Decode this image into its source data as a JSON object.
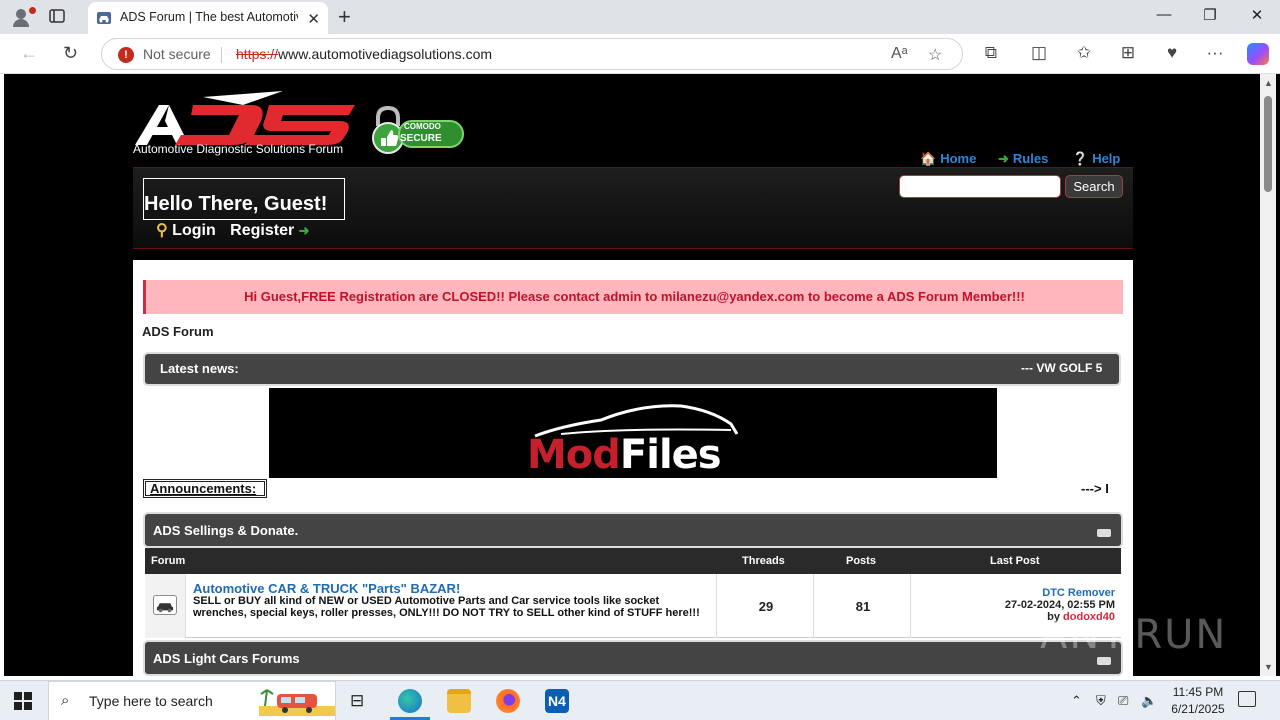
{
  "browser": {
    "tab_title": "ADS Forum | The best Automotive",
    "security_label": "Not secure",
    "url_protocol": "https://",
    "url_rest": "www.automotivediagsolutions.com"
  },
  "header": {
    "logo_caption": "Automotive Diagnostic Solutions Forum",
    "comodo_line1": "COMODO",
    "comodo_line2": "SECURE",
    "links": {
      "home": "Home",
      "rules": "Rules",
      "help": "Help"
    },
    "greeting": "Hello There, Guest!",
    "login": "Login",
    "register": "Register",
    "search_button": "Search",
    "search_value": ""
  },
  "content": {
    "notice": "Hi Guest,FREE Registration are CLOSED!! Please contact admin to milanezu@yandex.com to become a ADS Forum Member!!!",
    "breadcrumb": "ADS Forum",
    "latest_news_label": "Latest news:",
    "news_ticker": "--- VW GOLF 5",
    "banner_mod": "Mod",
    "banner_files": "Files",
    "announcements_label": "Announcements:",
    "announcements_ticker": "---> I",
    "categories": [
      {
        "name": "ADS Sellings & Donate."
      },
      {
        "name": "ADS Light Cars Forums"
      }
    ],
    "table_headers": {
      "forum": "Forum",
      "threads": "Threads",
      "posts": "Posts",
      "last_post": "Last Post"
    },
    "forums": [
      {
        "name": "Automotive CAR & TRUCK \"Parts\" BAZAR!",
        "description": "SELL or BUY all kind of NEW or USED Automotive Parts and Car service tools like socket wrenches, special keys, roller presses, ONLY!!! DO NOT TRY to SELL other kind of STUFF here!!!",
        "threads": "29",
        "posts": "81",
        "last_post_title": "DTC Remover",
        "last_post_date": "27-02-2024, 02:55 PM",
        "last_post_by_prefix": "by",
        "last_post_user": "dodoxd40"
      }
    ]
  },
  "watermark": "ANY.RUN",
  "taskbar": {
    "search_placeholder": "Type here to search",
    "time": "11:45 PM",
    "date": "6/21/2025"
  },
  "colors": {
    "accent_red": "#d9263b",
    "link_blue": "#1e6bb8",
    "header_link_blue": "#2e86d9",
    "category_bar": "#444444"
  },
  "icons": [
    "profile-icon",
    "tab-actions-icon",
    "car-favicon-icon",
    "back-icon",
    "refresh-icon",
    "warning-icon",
    "read-aloud-icon",
    "favorite-star-icon",
    "extensions-icon",
    "split-screen-icon",
    "favorites-icon",
    "collections-icon",
    "performance-icon",
    "more-icon",
    "copilot-icon",
    "home-icon",
    "arrow-right-icon",
    "help-icon",
    "key-icon",
    "forum-car-icon",
    "windows-start-icon",
    "search-icon",
    "task-view-icon",
    "edge-icon",
    "file-explorer-icon",
    "firefox-icon",
    "n4-icon",
    "chevron-up-icon",
    "network-icon",
    "volume-icon",
    "notification-icon"
  ]
}
